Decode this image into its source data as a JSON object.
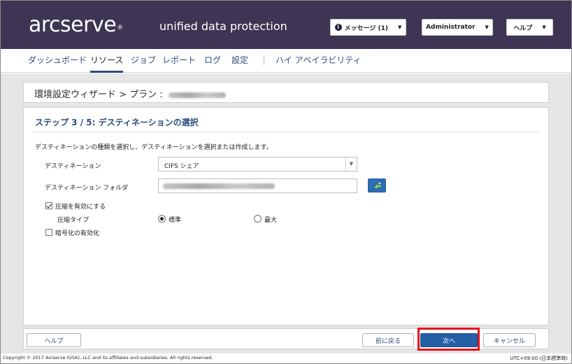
{
  "header": {
    "logo": "arcserve",
    "logo_mark": "®",
    "product": "unified data protection",
    "messages_label": "メッセージ (1)",
    "user_label": "Administrator",
    "help_label": "ヘルプ"
  },
  "nav": {
    "items": [
      "ダッシュボード",
      "リソース",
      "ジョブ",
      "レポート",
      "ログ",
      "設定",
      "ハイ アベイラビリティ"
    ]
  },
  "breadcrumb": "環境設定ウィザード > プラン :",
  "wizard": {
    "step_title": "ステップ 3 / 5: デスティネーションの選択",
    "description": "デスティネーションの種類を選択し、デスティネーションを選択または作成します。",
    "destination_label": "デスティネーション",
    "destination_value": "CIFS シェア",
    "folder_label": "デスティネーション フォルダ",
    "compress_label": "圧縮を有効にする",
    "compress_checked": true,
    "compress_type_label": "圧縮タイプ",
    "compress_standard": "標準",
    "compress_max": "最大",
    "encrypt_label": "暗号化の有効化",
    "encrypt_checked": false
  },
  "buttons": {
    "help": "ヘルプ",
    "back": "前に戻る",
    "next": "次へ",
    "cancel": "キャンセル"
  },
  "footer": {
    "copyright": "Copyright © 2017 Arcserve (USA), LLC and its affiliates and subsidiaries. All rights reserved.",
    "timezone": "UTC+09:00 (日本標準時)"
  },
  "colors": {
    "header_bg": "#3d3553",
    "accent": "#2c4c7c",
    "primary_button": "#2460a6",
    "highlight": "#e3141d"
  }
}
